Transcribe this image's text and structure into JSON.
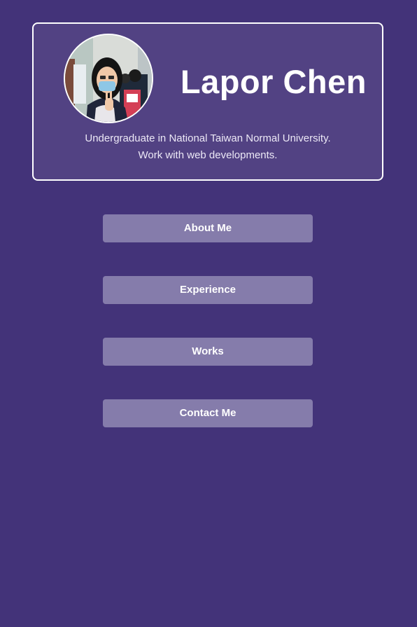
{
  "profile": {
    "name": "Lapor Chen",
    "bio_line1": "Undergraduate in National Taiwan Normal University.",
    "bio_line2": "Work with web developments."
  },
  "nav": {
    "about": "About Me",
    "experience": "Experience",
    "works": "Works",
    "contact": "Contact Me"
  },
  "colors": {
    "background": "#433379",
    "card": "#524283",
    "button": "#857cab",
    "text": "#ffffff"
  }
}
